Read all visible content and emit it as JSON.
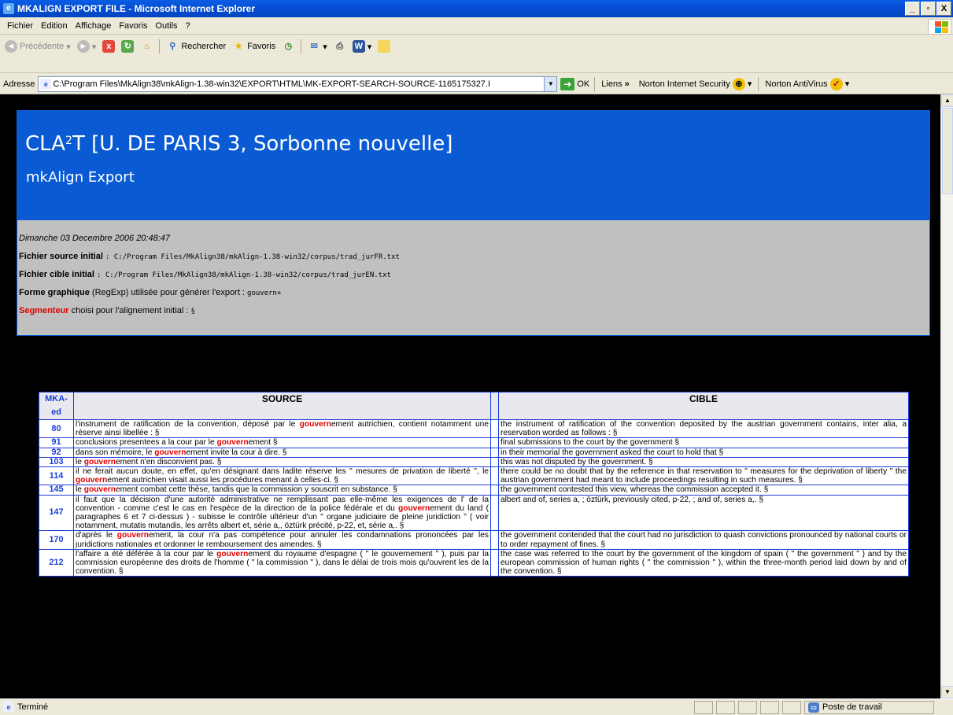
{
  "window": {
    "title": "MKALIGN EXPORT FILE - Microsoft Internet Explorer",
    "min": "_",
    "max": "× ",
    "close": "X"
  },
  "menu": [
    "Fichier",
    "Edition",
    "Affichage",
    "Favoris",
    "Outils",
    "?"
  ],
  "toolbar": {
    "back": "Précédente",
    "search": "Rechercher",
    "favorites": "Favoris"
  },
  "address": {
    "label": "Adresse",
    "url": "C:\\Program Files\\MkAlign38\\mkAlign-1.38-win32\\EXPORT\\HTML\\MK-EXPORT-SEARCH-SOURCE-1165175327.I",
    "go": "OK",
    "links": "Liens",
    "links_chevron": "»",
    "norton_is": "Norton Internet Security",
    "norton_av": "Norton AntiVirus"
  },
  "page": {
    "title_pre": "CLA",
    "title_sup": "2",
    "title_post": "T [U. DE PARIS 3, Sorbonne nouvelle]",
    "subtitle": "mkAlign Export",
    "date": "Dimanche 03 Decembre 2006 20:48:47",
    "source_label": "Fichier source initial",
    "source_path": ": C:/Program Files/MkAlign38/mkAlign-1.38-win32/corpus/trad_jurFR.txt",
    "target_label": "Fichier cible initial",
    "target_path": ": C:/Program Files/MkAlign38/mkAlign-1.38-win32/corpus/trad_jurEN.txt",
    "forme_label": "Forme graphique",
    "forme_text": " (RegExp) utilisée pour générer l'export : ",
    "forme_value": "gouvern+",
    "seg_label": "Segmenteur",
    "seg_text": " choisi pour l'alignement initial : ",
    "seg_value": "§"
  },
  "table": {
    "headers": {
      "id": "MKA-ed",
      "source": "SOURCE",
      "target": "CIBLE"
    },
    "rows": [
      {
        "id": "80",
        "src_pre": "l'instrument de ratification de la convention, déposé par le ",
        "src_hl": "gouvern",
        "src_post": "ement autrichien, contient notamment une réserve ainsi libellée : §",
        "tgt": "the instrument of ratification of the convention deposited by the austrian government contains, inter alia, a reservation worded as follows : §"
      },
      {
        "id": "91",
        "src_pre": "conclusions presentees a la cour par le ",
        "src_hl": "gouvern",
        "src_post": "ement §",
        "tgt": "final submissions to the court by the government §"
      },
      {
        "id": "92",
        "src_pre": "dans son mémoire, le ",
        "src_hl": "gouvern",
        "src_post": "ement invite la cour à dire. §",
        "tgt": "in their memorial the government asked the court to hold that §"
      },
      {
        "id": "103",
        "src_pre": "le ",
        "src_hl": "gouvern",
        "src_post": "ement n'en disconvient pas. §",
        "tgt": "this was not disputed by the government. §"
      },
      {
        "id": "114",
        "src_pre": "il ne ferait aucun doute, en effet, qu'en désignant dans ladite réserve les \" mesures de privation de liberté \", le ",
        "src_hl": "gouvern",
        "src_post": "ement autrichien visait aussi les procédures menant à celles-ci. §",
        "tgt": "there could be no doubt that by the reference in that reservation to \" measures for the deprivation of liberty \" the austrian government had meant to include proceedings resulting in such measures. §"
      },
      {
        "id": "145",
        "src_pre": "le ",
        "src_hl": "gouvern",
        "src_post": "ement combat cette thèse, tandis que la commission y souscrit en substance. §",
        "tgt": "the government contested this view, whereas the commission accepted it. §"
      },
      {
        "id": "147",
        "src_pre": "il faut que la décision d'une autorité administrative ne remplissant pas elle-même les exigences de l' de la convention - comme c'est le cas en l'espèce de la direction de la police fédérale et du ",
        "src_hl": "gouvern",
        "src_post": "ement du land ( paragraphes 6 et 7 ci-dessus ) - subisse le contrôle ultérieur d'un \" organe judiciaire de pleine juridiction \" ( voir notamment, mutatis mutandis, les arrêts albert et, série a,, öztürk précité, p-22, et, série a,. §",
        "tgt": "albert and of, series a, ; öztürk, previously cited, p-22, ; and of, series a,. §"
      },
      {
        "id": "170",
        "src_pre": "d'après le ",
        "src_hl": "gouvern",
        "src_post": "ement, la cour n'a pas compétence pour annuler les condamnations prononcées par les juridictions nationales et ordonner le remboursement des amendes. §",
        "tgt": "the government contended that the court had no jurisdiction to quash convictions pronounced by national courts or to order repayment of fines. §"
      },
      {
        "id": "212",
        "src_pre": "l'affaire a été déférée à la cour par le ",
        "src_hl": "gouvern",
        "src_post": "ement du royaume d'espagne ( \" le gouvernement \" ), puis par la commission européenne des droits de l'homme ( \" la commission \" ), dans le délai de trois mois qu'ouvrent les de la convention. §",
        "tgt": "the case was referred to the court by the government of the kingdom of spain ( \" the government \" ) and by the european commission of human rights ( \" the commission \" ), within the three-month period laid down by and of the convention. §"
      }
    ]
  },
  "status": {
    "text": "Terminé",
    "zone": "Poste de travail"
  }
}
